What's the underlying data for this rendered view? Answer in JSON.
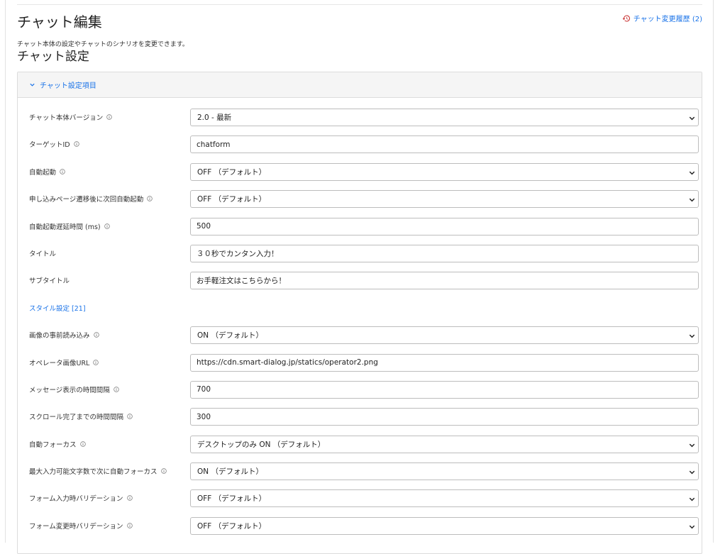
{
  "page": {
    "title": "チャット編集",
    "description": "チャット本体の設定やチャットのシナリオを変更できます。",
    "history_link": "チャット変更履歴 (2)"
  },
  "section": {
    "title": "チャット設定",
    "panel_label": "チャット設定項目",
    "style_link": "スタイル設定 [21]"
  },
  "fields": [
    {
      "label": "チャット本体バージョン",
      "type": "select",
      "value": "2.0 - 最新",
      "info": true
    },
    {
      "label": "ターゲットID",
      "type": "input",
      "value": "chatform",
      "info": true
    },
    {
      "label": "自動起動",
      "type": "select",
      "value": "OFF （デフォルト）",
      "info": true
    },
    {
      "label": "申し込みページ遷移後に次回自動起動",
      "type": "select",
      "value": "OFF （デフォルト）",
      "info": true
    },
    {
      "label": "自動起動遅延時間 (ms)",
      "type": "input",
      "value": "500",
      "info": true
    },
    {
      "label": "タイトル",
      "type": "input",
      "value": "３０秒でカンタン入力！",
      "info": false
    },
    {
      "label": "サブタイトル",
      "type": "input",
      "value": "お手軽注文はこちらから！",
      "info": false
    },
    {
      "label": "画像の事前読み込み",
      "type": "select",
      "value": "ON （デフォルト）",
      "info": true
    },
    {
      "label": "オペレータ画像URL",
      "type": "input",
      "value": "https://cdn.smart-dialog.jp/statics/operator2.png",
      "info": true
    },
    {
      "label": "メッセージ表示の時間間隔",
      "type": "input",
      "value": "700",
      "info": true
    },
    {
      "label": "スクロール完了までの時間間隔",
      "type": "input",
      "value": "300",
      "info": true
    },
    {
      "label": "自動フォーカス",
      "type": "select",
      "value": "デスクトップのみ ON （デフォルト）",
      "info": true
    },
    {
      "label": "最大入力可能文字数で次に自動フォーカス",
      "type": "select",
      "value": "ON （デフォルト）",
      "info": true
    },
    {
      "label": "フォーム入力時バリデーション",
      "type": "select",
      "value": "OFF （デフォルト）",
      "info": true
    },
    {
      "label": "フォーム変更時バリデーション",
      "type": "select",
      "value": "OFF （デフォルト）",
      "info": true
    }
  ]
}
